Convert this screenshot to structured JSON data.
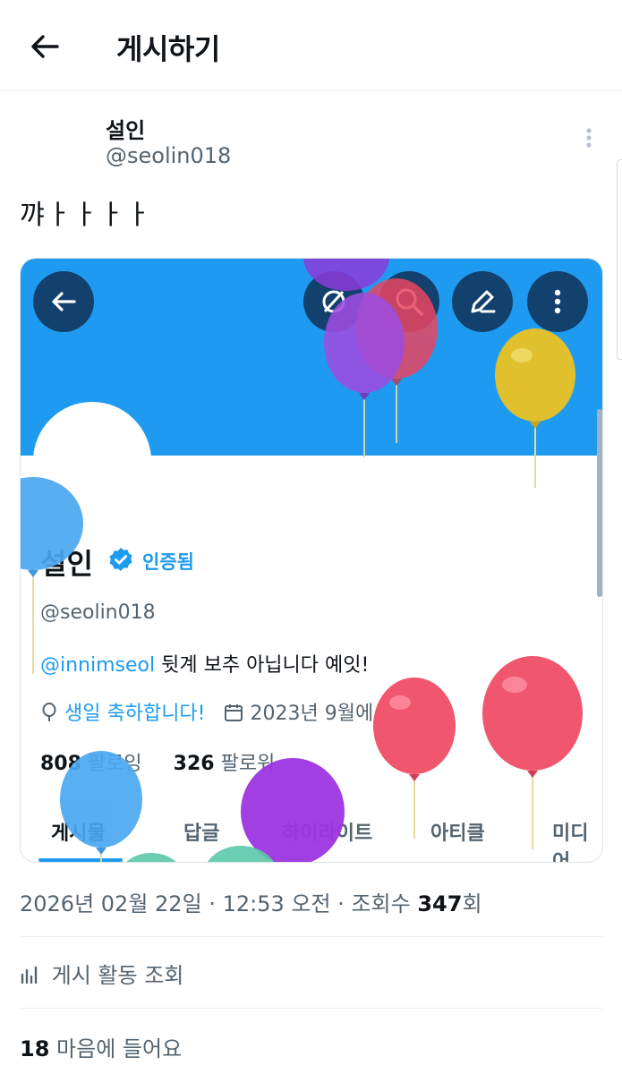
{
  "header": {
    "title": "게시하기"
  },
  "post": {
    "author_name": "설인",
    "author_handle": "@seolin018",
    "text": "꺄ㅏㅏㅏㅏ"
  },
  "embedded_profile": {
    "name": "설인",
    "verified_label": "인증됨",
    "handle": "@seolin018",
    "bio_mention": "@innimseol",
    "bio_text": " 뒷계 보추 아닙니다 예잇!",
    "birthday": "생일 축하합니다!",
    "joined": "2023년 9월에 가입함",
    "following_count": "808",
    "following_label": "팔로잉",
    "followers_count": "326",
    "followers_label": "팔로워",
    "tabs": [
      "게시물",
      "답글",
      "하이라이트",
      "아티클",
      "미디어"
    ],
    "active_tab": 0,
    "balloon_colors": [
      "#8c3bd9",
      "#e94560",
      "#e0c02c",
      "#4aa8f0",
      "#f0566e",
      "#5bc8a8"
    ]
  },
  "meta": {
    "date": "2026년 02월 22일",
    "time": "12:53 오전",
    "views_label": "조회수",
    "views_count": "347",
    "views_suffix": "회",
    "activity_label": "게시 활동 조회",
    "likes_count": "18",
    "likes_label": "마음에 들어요"
  },
  "colors": {
    "accent": "#1d9bf0",
    "banner": "#1e9bf0",
    "text": "#0f1419",
    "muted": "#536471"
  },
  "icons": [
    "back-arrow-icon",
    "more-vertical-icon",
    "search-icon",
    "edit-icon",
    "verified-badge-icon",
    "balloon-icon",
    "calendar-icon",
    "chart-icon"
  ]
}
